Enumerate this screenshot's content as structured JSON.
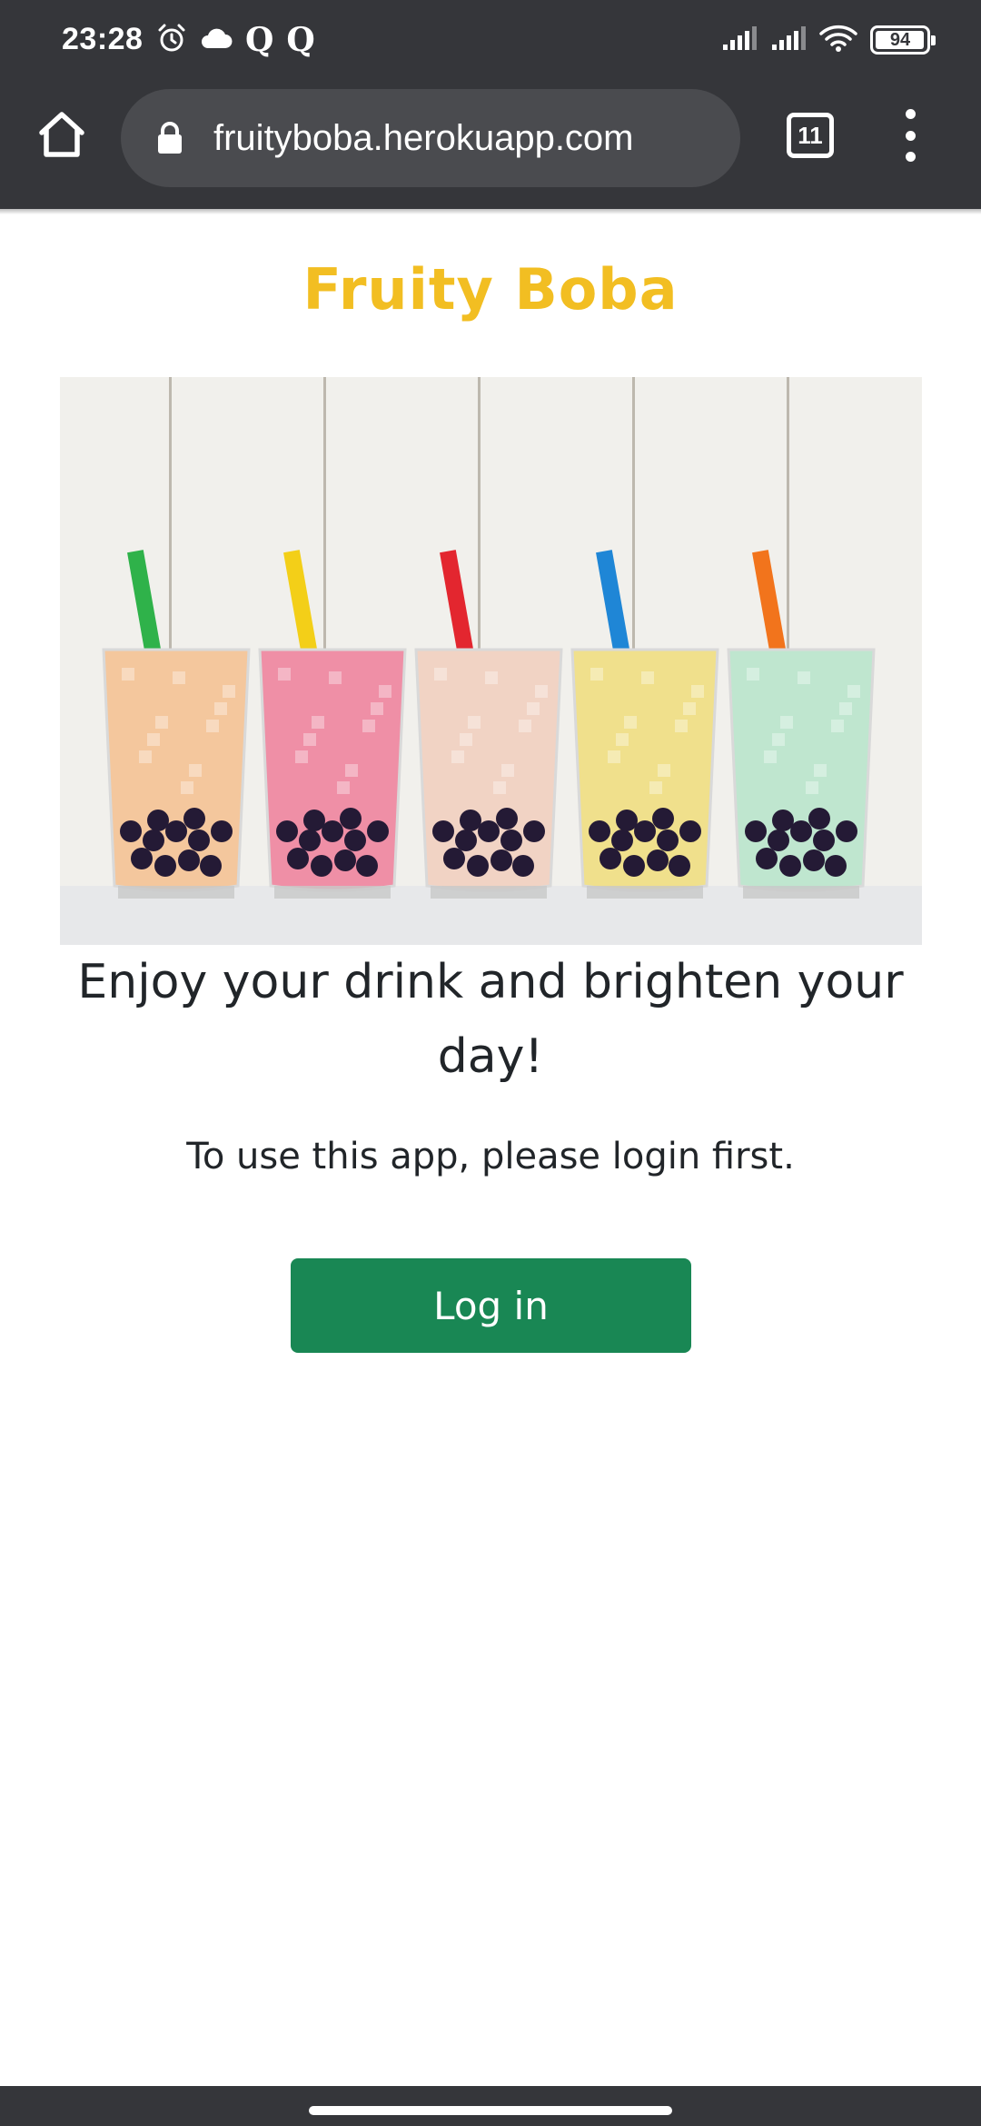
{
  "status_bar": {
    "time": "23:28",
    "left_icons": [
      "alarm-icon",
      "cloud-icon",
      "q-notification-icon",
      "q-notification-icon"
    ],
    "right_icons": [
      "signal-icon",
      "signal-icon",
      "wifi-icon",
      "battery-icon"
    ],
    "battery_level": "94"
  },
  "browser": {
    "url": "fruityboba.herokuapp.com",
    "tab_count": "11",
    "icons": {
      "home": "home-icon",
      "lock": "lock-icon",
      "tabs": "tabs-icon",
      "menu": "more-vert-icon"
    },
    "toolbar_color": "#35363a",
    "url_bar_color": "#4a4b4f"
  },
  "page": {
    "brand": "Fruity Boba",
    "brand_color": "#f2be22",
    "hero_drinks": [
      {
        "drink": "#f4c79d",
        "straw": "#2fb24a"
      },
      {
        "drink": "#ef8fa6",
        "straw": "#f3cf18"
      },
      {
        "drink": "#f1d3c4",
        "straw": "#e3262f"
      },
      {
        "drink": "#f0e08c",
        "straw": "#1f86d6"
      },
      {
        "drink": "#bfe6cf",
        "straw": "#f2741c"
      }
    ],
    "headline": "Enjoy your drink and brighten your day!",
    "subtext": "To use this app, please login first.",
    "login_button": "Log in",
    "button_color": "#198754"
  }
}
